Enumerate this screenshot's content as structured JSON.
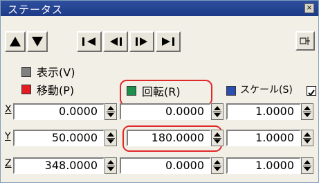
{
  "window": {
    "title": "ステータス"
  },
  "toolbar": {
    "buttons": [
      "move-up",
      "move-down",
      "first",
      "prev",
      "next",
      "last"
    ],
    "pin_label": "pin-icon"
  },
  "checks": {
    "display_label": "表示(V)",
    "move_label": "移動(P)",
    "rotate_label": "回転(R)",
    "scale_label": "スケール(S)"
  },
  "colors": {
    "display": "#808080",
    "move": "#e31b23",
    "rotate": "#1c8f4a",
    "scale": "#2a4fb0",
    "highlight": "#e02a2a"
  },
  "rows": [
    {
      "label": "X",
      "values": [
        "0.0000",
        "0.0000",
        "1.0000"
      ]
    },
    {
      "label": "Y",
      "values": [
        "50.0000",
        "180.0000",
        "1.0000"
      ]
    },
    {
      "label": "Z",
      "values": [
        "348.0000",
        "0.0000",
        "1.0000"
      ]
    }
  ]
}
